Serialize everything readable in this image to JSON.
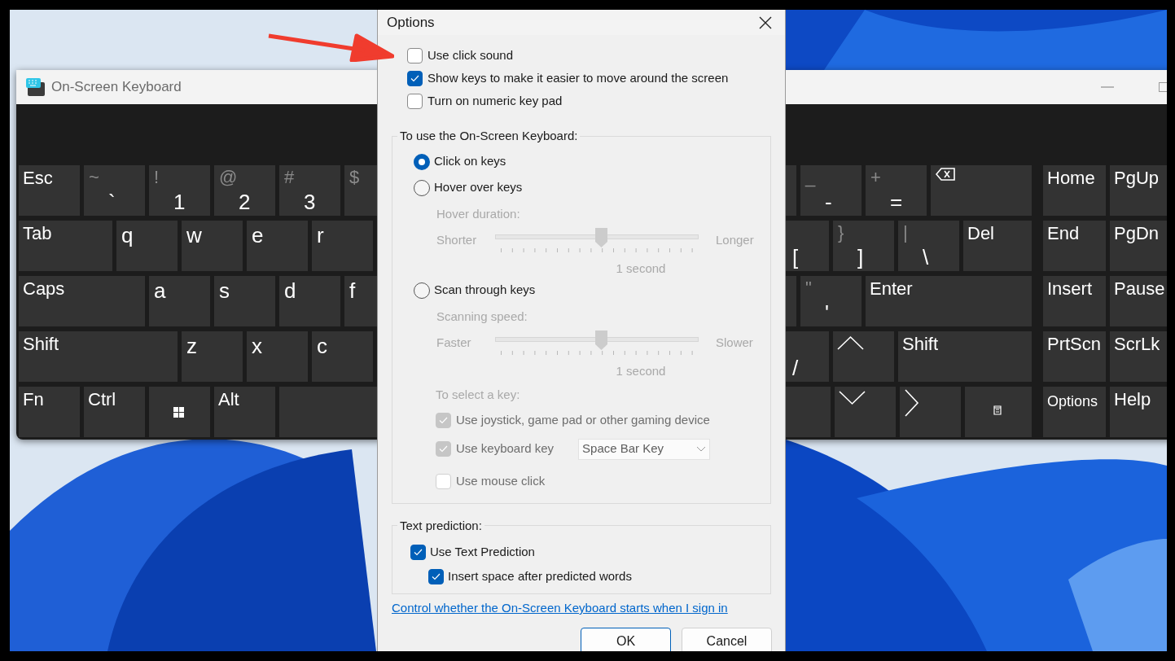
{
  "keyboard_window": {
    "title": "On-Screen Keyboard",
    "rows": [
      {
        "left": [
          {
            "kind": "text",
            "label": "Esc"
          },
          {
            "kind": "symbol",
            "shift": "~",
            "label": "`"
          },
          {
            "kind": "symbol",
            "shift": "!",
            "label": "1"
          },
          {
            "kind": "symbol",
            "shift": "@",
            "label": "2"
          },
          {
            "kind": "symbol",
            "shift": "#",
            "label": "3"
          },
          {
            "kind": "symbol",
            "shift": "$"
          }
        ],
        "right": [
          {
            "kind": "blank"
          },
          {
            "kind": "symbol",
            "shift": "_",
            "label": "-"
          },
          {
            "kind": "symbol",
            "shift": "+",
            "label": "="
          },
          {
            "kind": "backspace"
          }
        ]
      },
      {
        "left": [
          {
            "kind": "text",
            "label": "Tab"
          },
          {
            "kind": "letter",
            "label": "q"
          },
          {
            "kind": "letter",
            "label": "w"
          },
          {
            "kind": "letter",
            "label": "e"
          },
          {
            "kind": "letter",
            "label": "r"
          }
        ],
        "right": [
          {
            "kind": "symbol",
            "label": "["
          },
          {
            "kind": "symbol",
            "shift": "}",
            "label": "]"
          },
          {
            "kind": "symbol",
            "shift": "|",
            "label": "\\"
          },
          {
            "kind": "text",
            "label": "Del"
          }
        ]
      },
      {
        "left": [
          {
            "kind": "text",
            "label": "Caps"
          },
          {
            "kind": "letter",
            "label": "a"
          },
          {
            "kind": "letter",
            "label": "s"
          },
          {
            "kind": "letter",
            "label": "d"
          },
          {
            "kind": "letter",
            "label": "f"
          }
        ],
        "right": [
          {
            "kind": "blank"
          },
          {
            "kind": "symbol",
            "shift": "\"",
            "label": "'"
          },
          {
            "kind": "text",
            "label": "Enter"
          }
        ]
      },
      {
        "left": [
          {
            "kind": "text",
            "label": "Shift"
          },
          {
            "kind": "letter",
            "label": "z"
          },
          {
            "kind": "letter",
            "label": "x"
          },
          {
            "kind": "letter",
            "label": "c"
          }
        ],
        "right": [
          {
            "kind": "symbol",
            "label": "/"
          },
          {
            "kind": "up"
          },
          {
            "kind": "text",
            "label": "Shift"
          }
        ]
      },
      {
        "left": [
          {
            "kind": "text",
            "label": "Fn"
          },
          {
            "kind": "text",
            "label": "Ctrl"
          },
          {
            "kind": "windows"
          },
          {
            "kind": "text",
            "label": "Alt"
          },
          {
            "kind": "blank"
          }
        ],
        "right": [
          {
            "kind": "blank"
          },
          {
            "kind": "down"
          },
          {
            "kind": "right"
          },
          {
            "kind": "menu"
          }
        ]
      }
    ],
    "nav_rows": [
      [
        {
          "kind": "text",
          "label": "Home"
        },
        {
          "kind": "text",
          "label": "PgUp"
        }
      ],
      [
        {
          "kind": "text",
          "label": "End"
        },
        {
          "kind": "text",
          "label": "PgDn"
        }
      ],
      [
        {
          "kind": "text",
          "label": "Insert"
        },
        {
          "kind": "text",
          "label": "Pause"
        }
      ],
      [
        {
          "kind": "text",
          "label": "PrtScn"
        },
        {
          "kind": "text",
          "label": "ScrLk"
        }
      ],
      [
        {
          "kind": "small",
          "label": "Options"
        },
        {
          "kind": "text",
          "label": "Help"
        }
      ]
    ]
  },
  "options_dialog": {
    "title": "Options",
    "checkboxes": [
      {
        "label": "Use click sound",
        "checked": false
      },
      {
        "label": "Show keys to make it easier to move around the screen",
        "checked": true
      },
      {
        "label": "Turn on numeric key pad",
        "checked": false
      }
    ],
    "usage_group": {
      "legend": "To use the On-Screen Keyboard:",
      "modes": [
        {
          "label": "Click on keys",
          "selected": true
        },
        {
          "label": "Hover over keys",
          "selected": false,
          "setting": {
            "label": "Hover duration:",
            "min_label": "Shorter",
            "max_label": "Longer",
            "level": 0.52,
            "reading": "1 second",
            "disabled": true
          }
        },
        {
          "label": "Scan through keys",
          "selected": false,
          "setting": {
            "label": "Scanning speed:",
            "min_label": "Faster",
            "max_label": "Slower",
            "level": 0.52,
            "reading": "1 second",
            "disabled": true
          },
          "select_key": {
            "label": "To select a key:",
            "disabled": true,
            "options": [
              {
                "label": "Use joystick, game pad or other gaming device",
                "checked": true,
                "disabled": true
              },
              {
                "label": "Use keyboard key",
                "checked": true,
                "disabled": true,
                "dropdown": "Space Bar Key"
              },
              {
                "label": "Use mouse click",
                "checked": false,
                "disabled": true
              }
            ]
          }
        }
      ]
    },
    "prediction_group": {
      "legend": "Text prediction:",
      "options": [
        {
          "label": "Use Text Prediction",
          "checked": true,
          "children": [
            {
              "label": "Insert space after predicted words",
              "checked": true
            }
          ]
        }
      ]
    },
    "link": "Control whether the On-Screen Keyboard starts when I sign in",
    "buttons": [
      {
        "label": "OK",
        "default": true
      },
      {
        "label": "Cancel",
        "default": false
      }
    ]
  }
}
